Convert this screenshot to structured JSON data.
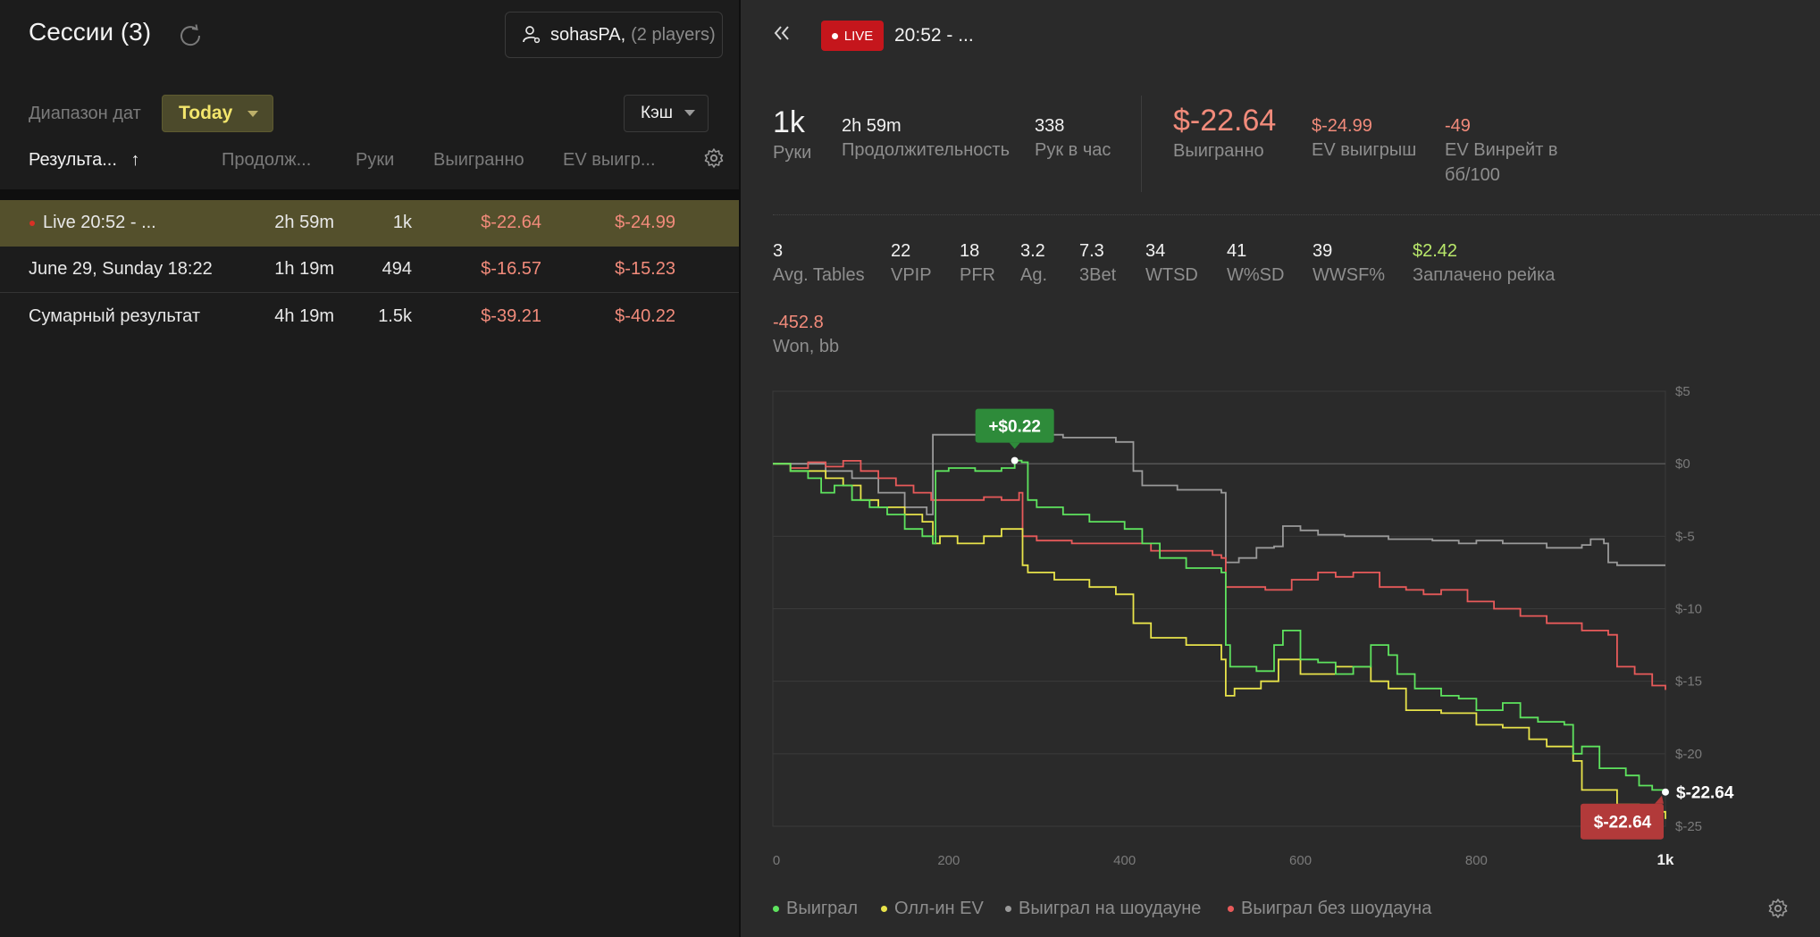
{
  "sidebar": {
    "title": "Сессии (3)",
    "player_name": "sohasPA,",
    "player_count": "(2 players)",
    "date_range_label": "Диапазон дат",
    "date_range_value": "Today",
    "game_type": "Кэш",
    "columns": [
      "Результа...",
      "Продолж...",
      "Руки",
      "Выигранно",
      "EV выигр..."
    ],
    "sort_arrow": "↑",
    "rows": [
      {
        "name": "Live 20:52 - ...",
        "duration": "2h 59m",
        "hands": "1k",
        "won": "$-22.64",
        "ev": "$-24.99"
      },
      {
        "name": "June 29, Sunday 18:22",
        "duration": "1h 19m",
        "hands": "494",
        "won": "$-16.57",
        "ev": "$-15.23"
      },
      {
        "name": "Сумарный результат",
        "duration": "4h 19m",
        "hands": "1.5k",
        "won": "$-39.21",
        "ev": "$-40.22"
      }
    ]
  },
  "session": {
    "live_label": "LIVE",
    "title": "20:52 - ...",
    "hands": {
      "value": "1k",
      "label": "Руки"
    },
    "duration": {
      "value": "2h 59m",
      "label": "Продолжительность"
    },
    "hands_per_hour": {
      "value": "338",
      "label": "Рук в час"
    },
    "won": {
      "value": "$-22.64",
      "label": "Выигранно"
    },
    "ev_won": {
      "value": "$-24.99",
      "label": "EV выигрыш"
    },
    "ev_winrate": {
      "value": "-49",
      "label_line1": "EV Винрейт в",
      "label_line2": "бб/100"
    },
    "stats": [
      {
        "value": "3",
        "label": "Avg. Tables"
      },
      {
        "value": "22",
        "label": "VPIP"
      },
      {
        "value": "18",
        "label": "PFR"
      },
      {
        "value": "3.2",
        "label": "Ag."
      },
      {
        "value": "7.3",
        "label": "3Bet"
      },
      {
        "value": "34",
        "label": "WTSD"
      },
      {
        "value": "41",
        "label": "W%SD"
      },
      {
        "value": "39",
        "label": "WWSF%"
      },
      {
        "value": "$2.42",
        "label": "Заплачено рейка"
      }
    ],
    "won_bb": {
      "value": "-452.8",
      "label": "Won, bb"
    }
  },
  "legend": [
    "Выиграл",
    "Олл-ин EV",
    "Выиграл на шоудауне",
    "Выиграл без шоудауна"
  ],
  "colors": {
    "won": "#5ee35e",
    "allin_ev": "#e8e34a",
    "showdown": "#9a9a9a",
    "non_showdown": "#e85a5a",
    "negative_text": "#f28b7b",
    "rake_text": "#b9e86a",
    "live_badge": "#c5161c",
    "today_btn": "#4c4a2b"
  },
  "chart_data": {
    "type": "line",
    "x_tick_labels": [
      "0",
      "200",
      "400",
      "600",
      "800",
      "1k"
    ],
    "y_tick_labels": [
      "$5",
      "$0",
      "$-5",
      "$-10",
      "$-15",
      "$-20",
      "$-25"
    ],
    "xlim": [
      0,
      1015
    ],
    "ylim": [
      -25,
      5
    ],
    "peak_label": "+$0.22",
    "peak": {
      "x": 275,
      "y": 0.22
    },
    "end_label": "$-22.64",
    "end_badge_label": "$-22.64",
    "series": [
      {
        "key": "won",
        "x": [
          0,
          20,
          40,
          55,
          70,
          90,
          110,
          130,
          150,
          170,
          182,
          185,
          200,
          230,
          260,
          275,
          283,
          290,
          300,
          330,
          360,
          400,
          420,
          440,
          470,
          510,
          515,
          520,
          550,
          570,
          580,
          600,
          620,
          640,
          660,
          680,
          700,
          710,
          730,
          760,
          780,
          800,
          830,
          850,
          870,
          900,
          910,
          920,
          940,
          970,
          985,
          1000,
          1015
        ],
        "y": [
          0,
          -0.5,
          -1,
          -2,
          -1.5,
          -2.5,
          -3,
          -3.5,
          -4.5,
          -5,
          -5.5,
          -0.5,
          -0.3,
          -0.5,
          -0.3,
          0.22,
          0.1,
          -2.5,
          -3,
          -3.5,
          -4,
          -4.5,
          -5.5,
          -6.5,
          -7.2,
          -7.5,
          -12.5,
          -14,
          -14.3,
          -12.5,
          -11.5,
          -13.5,
          -13.7,
          -14.5,
          -14,
          -12.5,
          -13.2,
          -14.5,
          -15.5,
          -16,
          -16.2,
          -17,
          -16.5,
          -17.5,
          -17.8,
          -18,
          -20,
          -19.5,
          -21,
          -21.5,
          -22.2,
          -22.5,
          -22.64
        ]
      },
      {
        "key": "allin_ev",
        "x": [
          0,
          20,
          40,
          60,
          80,
          100,
          120,
          150,
          170,
          182,
          190,
          210,
          240,
          260,
          280,
          284,
          290,
          320,
          360,
          390,
          410,
          430,
          470,
          510,
          515,
          525,
          555,
          575,
          600,
          640,
          680,
          700,
          720,
          760,
          800,
          830,
          860,
          880,
          910,
          920,
          935,
          960,
          985,
          1015
        ],
        "y": [
          0,
          -0.5,
          -0.5,
          -1,
          -1.5,
          -2.5,
          -3,
          -3.5,
          -4,
          -5.5,
          -5,
          -5.5,
          -5,
          -4.5,
          -4.5,
          -7,
          -7.5,
          -8,
          -8.5,
          -9,
          -11,
          -12,
          -12.5,
          -13.5,
          -16,
          -15.5,
          -15,
          -13.5,
          -14.5,
          -14,
          -15,
          -15.5,
          -17,
          -17.2,
          -18,
          -18.2,
          -19,
          -19.5,
          -20.5,
          -22.5,
          -22.5,
          -23.5,
          -24,
          -24.5
        ]
      },
      {
        "key": "showdown",
        "x": [
          0,
          60,
          90,
          120,
          150,
          175,
          182,
          190,
          230,
          260,
          300,
          330,
          390,
          410,
          420,
          460,
          510,
          515,
          530,
          550,
          570,
          580,
          600,
          620,
          650,
          700,
          750,
          780,
          800,
          830,
          860,
          880,
          920,
          930,
          945,
          950,
          960,
          1015
        ],
        "y": [
          0,
          -0.5,
          -1,
          -2,
          -3,
          -3.5,
          2,
          2,
          2,
          2,
          2,
          1.8,
          1.5,
          -0.5,
          -1.5,
          -1.8,
          -2,
          -6.8,
          -6.5,
          -5.8,
          -5.7,
          -4.3,
          -4.6,
          -4.9,
          -5,
          -5.2,
          -5.3,
          -5.5,
          -5.3,
          -5.5,
          -5.5,
          -5.8,
          -5.6,
          -5.2,
          -5.5,
          -6.8,
          -7,
          -7
        ]
      },
      {
        "key": "non_showdown",
        "x": [
          0,
          20,
          40,
          60,
          80,
          100,
          120,
          140,
          160,
          180,
          200,
          220,
          240,
          260,
          280,
          284,
          300,
          340,
          380,
          410,
          430,
          470,
          500,
          510,
          515,
          530,
          560,
          590,
          620,
          640,
          660,
          690,
          720,
          740,
          760,
          790,
          820,
          850,
          860,
          880,
          900,
          920,
          950,
          960,
          980,
          1000,
          1015
        ],
        "y": [
          0,
          -0.3,
          0.1,
          -0.2,
          0.2,
          -0.5,
          -1,
          -1.5,
          -2,
          -2.5,
          -2.5,
          -2.5,
          -2.3,
          -2.5,
          -2,
          -5,
          -5.3,
          -5.5,
          -5.5,
          -5.5,
          -6,
          -6,
          -6.3,
          -6.5,
          -8.5,
          -8.5,
          -8.7,
          -8,
          -7.5,
          -7.8,
          -7.5,
          -8.5,
          -8.7,
          -9,
          -8.7,
          -9.5,
          -10,
          -10.5,
          -10.5,
          -11,
          -11,
          -11.5,
          -11.8,
          -14,
          -14.5,
          -15.3,
          -15.6
        ]
      }
    ]
  }
}
